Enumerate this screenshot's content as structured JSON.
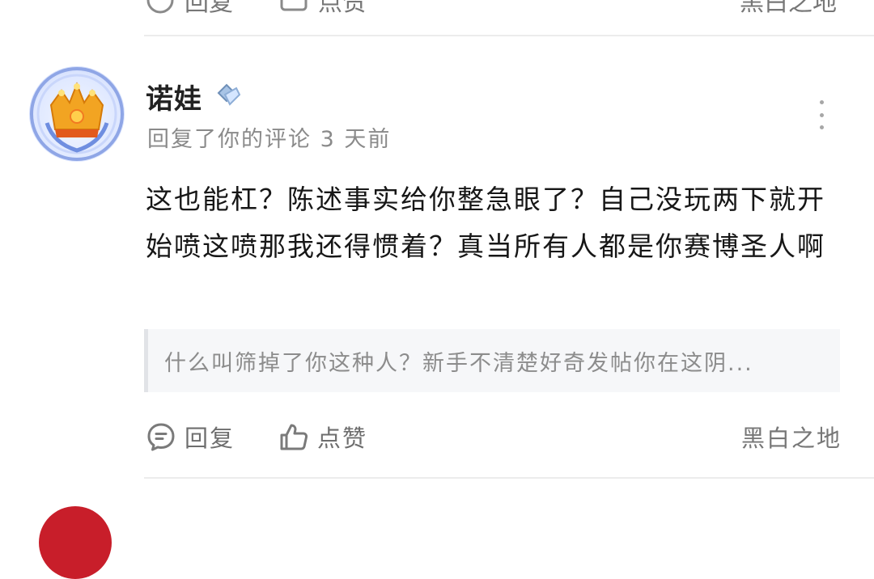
{
  "previous_item": {
    "reply_label": "回复",
    "like_label": "点赞",
    "zone_label": "黑白之地"
  },
  "comment": {
    "username": "诺娃",
    "meta": "回复了你的评论 3 天前",
    "text": "这也能杠？陈述事实给你整急眼了？自己没玩两下就开始喷这喷那我还得惯着？真当所有人都是你赛博圣人啊",
    "quoted_text": "什么叫筛掉了你这种人？新手不清楚好奇发帖你在这阴...",
    "actions": {
      "reply_label": "回复",
      "like_label": "点赞",
      "zone_label": "黑白之地"
    }
  },
  "colors": {
    "text_primary": "#1f1f1f",
    "text_secondary": "#8a8a8a",
    "divider": "#ececec",
    "quote_bg": "#f6f7f9"
  },
  "icons": [
    "comment-icon",
    "thumbs-up-icon",
    "more-vertical-icon",
    "badge-icon",
    "avatar-crown-icon"
  ]
}
